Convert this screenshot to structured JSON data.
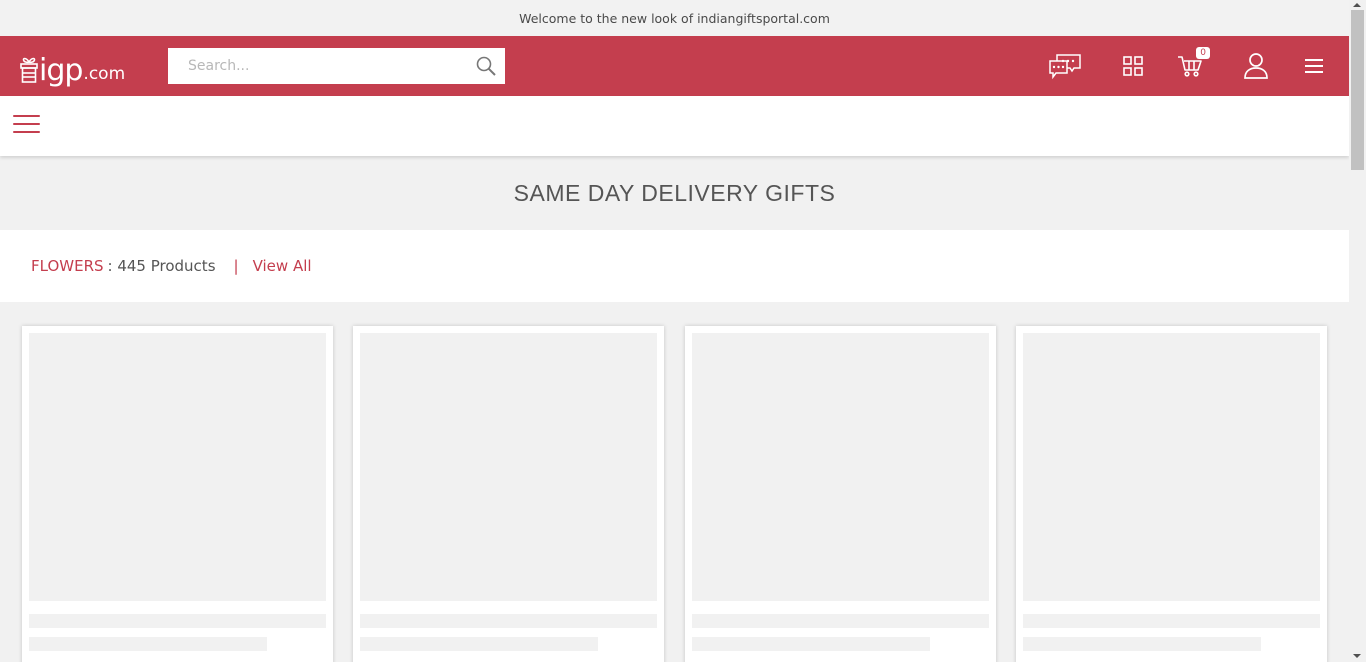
{
  "announcement": "Welcome to the new look of indiangiftsportal.com",
  "brand": {
    "logo_mark": "igp",
    "logo_suffix": ".com",
    "header_color": "#c43e4e"
  },
  "search": {
    "placeholder": "Search..."
  },
  "header_icons": {
    "chat": "chat-bubbles-icon",
    "categories": "grid-icon",
    "cart": "cart-icon",
    "cart_count": "0",
    "account": "user-icon",
    "menu": "hamburger-menu-icon"
  },
  "page": {
    "title": "SAME DAY DELIVERY GIFTS"
  },
  "category": {
    "name": "FLOWERS",
    "count_text": ": 445 Products",
    "separator": "|",
    "view_all": "View All"
  },
  "products_loading": 4
}
